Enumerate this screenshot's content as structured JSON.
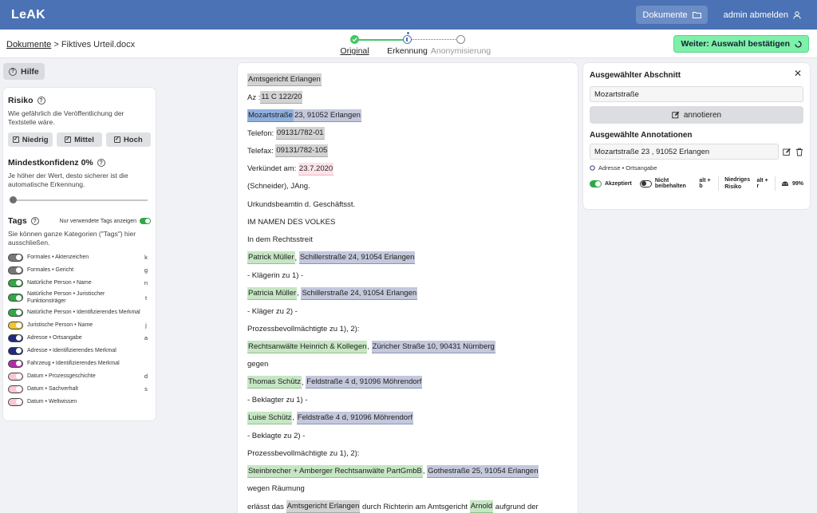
{
  "topbar": {
    "logo": "LeAK",
    "documents_label": "Dokumente",
    "logout_label": "admin abmelden"
  },
  "breadcrumb": {
    "root": "Dokumente",
    "separator": ">",
    "file": "Fiktives Urteil.docx"
  },
  "stepper": {
    "steps": [
      {
        "label": "Original",
        "state": "done"
      },
      {
        "label": "Erkennung",
        "state": "current"
      },
      {
        "label": "Anonymisierung",
        "state": "upcoming"
      }
    ]
  },
  "confirm_button": "Weiter: Auswahl bestätigen",
  "help_button": "Hilfe",
  "left": {
    "risk": {
      "title": "Risiko",
      "desc": "Wie gefährlich die Veröffentlichung der Textstelle wäre.",
      "buttons": [
        "Niedrig",
        "Mittel",
        "Hoch"
      ]
    },
    "confidence": {
      "title": "Mindestkonfidenz 0%",
      "desc": "Je höher der Wert, desto sicherer ist die automatische Erkennung.",
      "value": 0
    },
    "tags": {
      "title": "Tags",
      "show_used": "Nur verwendete Tags anzeigen",
      "desc": "Sie können ganze Kategorien (\"Tags\") hier ausschließen.",
      "items": [
        {
          "name": "Formales • Aktenzeichen",
          "key": "k",
          "color": "#777777"
        },
        {
          "name": "Formales • Gericht",
          "key": "g",
          "color": "#777777"
        },
        {
          "name": "Natürliche Person • Name",
          "key": "n",
          "color": "#2fa845"
        },
        {
          "name": "Natürliche Person • Juristischer Funktionsträger",
          "key": "t",
          "color": "#2fa845"
        },
        {
          "name": "Natürliche Person • Identifizierendes Merkmal",
          "key": "",
          "color": "#2fa845"
        },
        {
          "name": "Juristische Person • Name",
          "key": "j",
          "color": "#f2c531"
        },
        {
          "name": "Adresse • Ortsangabe",
          "key": "a",
          "color": "#1f2a7c"
        },
        {
          "name": "Adresse • Identifizierendes Merkmal",
          "key": "",
          "color": "#1f2a7c"
        },
        {
          "name": "Fahrzeug • Identifizierendes Merkmal",
          "key": "",
          "color": "#b02fa8"
        },
        {
          "name": "Datum • Prozessgeschichte",
          "key": "d",
          "color": "#f7c9d4"
        },
        {
          "name": "Datum • Sachverhalt",
          "key": "s",
          "color": "#f7c9d4"
        },
        {
          "name": "Datum • Weltwissen",
          "key": "",
          "color": "#f7c9d4"
        }
      ]
    }
  },
  "doc": {
    "lines": [
      [
        {
          "t": "Amtsgericht Erlangen",
          "h": "grey"
        }
      ],
      [
        {
          "t": "Az :"
        },
        {
          "t": "11 C 122/20",
          "h": "grey"
        }
      ],
      [
        {
          "t": "Mozartstraße",
          "h": "blueSel"
        },
        {
          "t": " 23, 91052 Erlangen",
          "h": "blue"
        }
      ],
      [
        {
          "t": "Telefon: "
        },
        {
          "t": "09131/782-01",
          "h": "grey"
        }
      ],
      [
        {
          "t": "Telefax: "
        },
        {
          "t": "09131/782-105",
          "h": "grey"
        }
      ],
      [
        {
          "t": "Verkündet am: "
        },
        {
          "t": "23.7.2020",
          "h": "pink"
        }
      ],
      [
        {
          "t": "(Schneider), JAng."
        }
      ],
      [
        {
          "t": "Urkundsbeamtin d. Geschäftsst."
        }
      ],
      [
        {
          "t": "IM NAMEN DES VOLKES"
        }
      ],
      [
        {
          "t": "In dem Rechtsstreit"
        }
      ],
      [
        {
          "t": "Patrick Müller",
          "h": "green"
        },
        {
          "t": ", "
        },
        {
          "t": "Schillerstraße 24, 91054 Erlangen",
          "h": "blue"
        }
      ],
      [
        {
          "t": "- Klägerin zu 1) -"
        }
      ],
      [
        {
          "t": "Patricia Müller",
          "h": "green"
        },
        {
          "t": ", "
        },
        {
          "t": "Schillerstraße 24, 91054 Erlangen",
          "h": "blue"
        }
      ],
      [
        {
          "t": "- Kläger zu 2) -"
        }
      ],
      [
        {
          "t": "Prozessbevollmächtigte zu 1), 2):"
        }
      ],
      [
        {
          "t": "Rechtsanwälte Heinrich & Kollegen",
          "h": "green"
        },
        {
          "t": ", "
        },
        {
          "t": "Züricher Straße 10, 90431 Nürnberg",
          "h": "blue"
        }
      ],
      [
        {
          "t": "gegen"
        }
      ],
      [
        {
          "t": "Thomas Schütz",
          "h": "green"
        },
        {
          "t": ", "
        },
        {
          "t": "Feldstraße 4 d, 91096 Möhrendorf",
          "h": "blue"
        }
      ],
      [
        {
          "t": "- Beklagter zu 1) -"
        }
      ],
      [
        {
          "t": "Luise Schütz",
          "h": "green"
        },
        {
          "t": ", "
        },
        {
          "t": "Feldstraße 4 d, 91096 Möhrendorf",
          "h": "blue"
        }
      ],
      [
        {
          "t": "- Beklagte zu 2) -"
        }
      ],
      [
        {
          "t": "Prozessbevollmächtigte zu 1), 2):"
        }
      ],
      [
        {
          "t": "Steinbrecher + Amberger Rechtsanwälte PartGmbB",
          "h": "green"
        },
        {
          "t": ", "
        },
        {
          "t": "Gothestraße 25, 91054 Erlangen",
          "h": "blue"
        }
      ],
      [
        {
          "t": "wegen Räumung"
        }
      ],
      [
        {
          "t": "erlässt das "
        },
        {
          "t": "Amtsgericht Erlangen",
          "h": "grey"
        },
        {
          "t": " durch Richterin am Amtsgericht "
        },
        {
          "t": "Arnold",
          "h": "green"
        },
        {
          "t": " aufgrund der"
        }
      ]
    ]
  },
  "right": {
    "selected_title": "Ausgewählter Abschnitt",
    "selected_value": "Mozartstraße",
    "annotate_label": "annotieren",
    "annotations_title": "Ausgewählte Annotationen",
    "annotation_value": "Mozartstraße 23 , 91052 Erlangen",
    "annotation_tag": "Adresse • Ortsangabe",
    "accepted_label": "Akzeptiert",
    "not_keep_label": "Nicht beibehalten",
    "not_keep_key": "alt + b",
    "risk_label": "Niedriges Risiko",
    "risk_key": "alt + r",
    "confidence": "99%"
  },
  "colors": {
    "topbar": "#4a72b4",
    "confirm": "#7ff0a9",
    "hl_grey": "#d3d3d3",
    "hl_blue": "#c4c8dc",
    "hl_blue_sel": "#8fb0de",
    "hl_green": "#c6e6c4",
    "hl_pink": "#fbe3e8"
  }
}
